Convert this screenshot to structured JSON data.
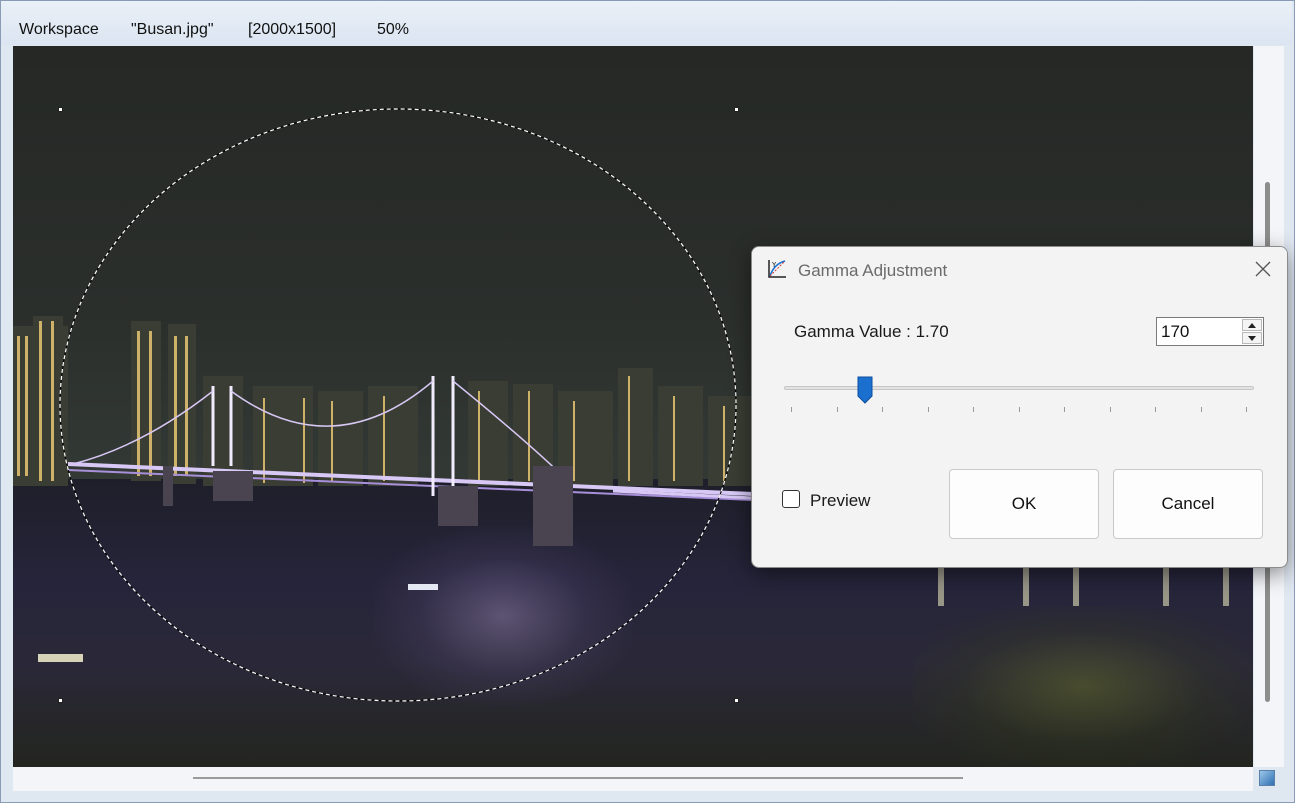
{
  "window": {
    "workspace_label": "Workspace",
    "file_name": "\"Busan.jpg\"",
    "image_size": "[2000x1500]",
    "zoom": "50%"
  },
  "canvas": {
    "image_subject": "night view of Gwangan bridge over water with city skyline",
    "selection_shape": "ellipse (dashed marquee) with corner handles"
  },
  "dialog": {
    "title": "Gamma Adjustment",
    "icon": "gamma-curve-icon",
    "close_icon": "close-icon",
    "gamma_label": "Gamma Value : 1.70",
    "gamma_input_value": "170",
    "slider": {
      "fraction": 0.17,
      "tick_count": 11
    },
    "preview_label": "Preview",
    "preview_checked": false,
    "ok_label": "OK",
    "cancel_label": "Cancel"
  },
  "colors": {
    "accent": "#1565c0",
    "slider_thumb": "#1a6fcf"
  }
}
